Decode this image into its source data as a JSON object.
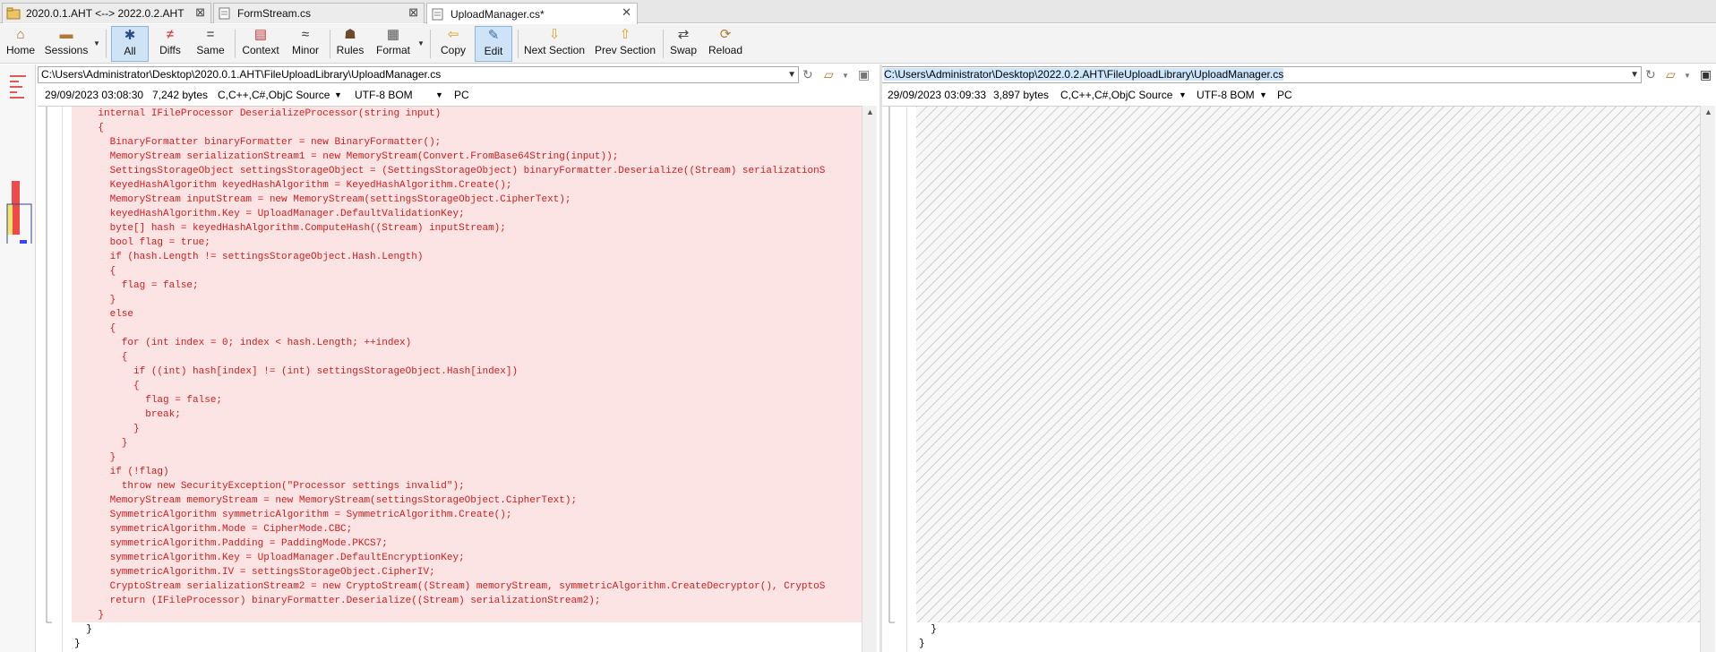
{
  "tabs": [
    {
      "label": "2020.0.1.AHT <--> 2022.0.2.AHT",
      "close": "⊠"
    },
    {
      "label": "FormStream.cs",
      "close": "⊠"
    },
    {
      "label": "UploadManager.cs*",
      "close": "✕"
    }
  ],
  "toolbar": {
    "home": "Home",
    "sessions": "Sessions",
    "all": "All",
    "diffs": "Diffs",
    "same": "Same",
    "context": "Context",
    "minor": "Minor",
    "rules": "Rules",
    "format": "Format",
    "copy": "Copy",
    "edit": "Edit",
    "next_section": "Next Section",
    "prev_section": "Prev Section",
    "swap": "Swap",
    "reload": "Reload"
  },
  "left": {
    "path": "C:\\Users\\Administrator\\Desktop\\2020.0.1.AHT\\FileUploadLibrary\\UploadManager.cs",
    "date": "29/09/2023 03:08:30",
    "size": "7,242 bytes",
    "format": "C,C++,C#,ObjC Source",
    "encoding": "UTF-8 BOM",
    "lineend": "PC"
  },
  "right": {
    "path": "C:\\Users\\Administrator\\Desktop\\2022.0.2.AHT\\FileUploadLibrary\\UploadManager.cs",
    "date": "29/09/2023 03:09:33",
    "size": "3,897 bytes",
    "format": "C,C++,C#,ObjC Source",
    "encoding": "UTF-8 BOM",
    "lineend": "PC"
  },
  "code_left": [
    "    internal IFileProcessor DeserializeProcessor(string input)",
    "    {",
    "      BinaryFormatter binaryFormatter = new BinaryFormatter();",
    "      MemoryStream serializationStream1 = new MemoryStream(Convert.FromBase64String(input));",
    "      SettingsStorageObject settingsStorageObject = (SettingsStorageObject) binaryFormatter.Deserialize((Stream) serializationS",
    "      KeyedHashAlgorithm keyedHashAlgorithm = KeyedHashAlgorithm.Create();",
    "      MemoryStream inputStream = new MemoryStream(settingsStorageObject.CipherText);",
    "      keyedHashAlgorithm.Key = UploadManager.DefaultValidationKey;",
    "      byte[] hash = keyedHashAlgorithm.ComputeHash((Stream) inputStream);",
    "      bool flag = true;",
    "      if (hash.Length != settingsStorageObject.Hash.Length)",
    "      {",
    "        flag = false;",
    "      }",
    "      else",
    "      {",
    "        for (int index = 0; index < hash.Length; ++index)",
    "        {",
    "          if ((int) hash[index] != (int) settingsStorageObject.Hash[index])",
    "          {",
    "            flag = false;",
    "            break;",
    "          }",
    "        }",
    "      }",
    "      if (!flag)",
    "        throw new SecurityException(\"Processor settings invalid\");",
    "      MemoryStream memoryStream = new MemoryStream(settingsStorageObject.CipherText);",
    "      SymmetricAlgorithm symmetricAlgorithm = SymmetricAlgorithm.Create();",
    "      symmetricAlgorithm.Mode = CipherMode.CBC;",
    "      symmetricAlgorithm.Padding = PaddingMode.PKCS7;",
    "      symmetricAlgorithm.Key = UploadManager.DefaultEncryptionKey;",
    "      symmetricAlgorithm.IV = settingsStorageObject.CipherIV;",
    "      CryptoStream serializationStream2 = new CryptoStream((Stream) memoryStream, symmetricAlgorithm.CreateDecryptor(), CryptoS",
    "      return (IFileProcessor) binaryFormatter.Deserialize((Stream) serializationStream2);",
    "    }"
  ],
  "code_left_tail": [
    "  }",
    "}"
  ],
  "code_right_tail": [
    "  }",
    "}"
  ],
  "colors": {
    "diff_bg": "#fde4e4",
    "diff_text": "#d81b1b",
    "accent": "#cfe3f6"
  }
}
